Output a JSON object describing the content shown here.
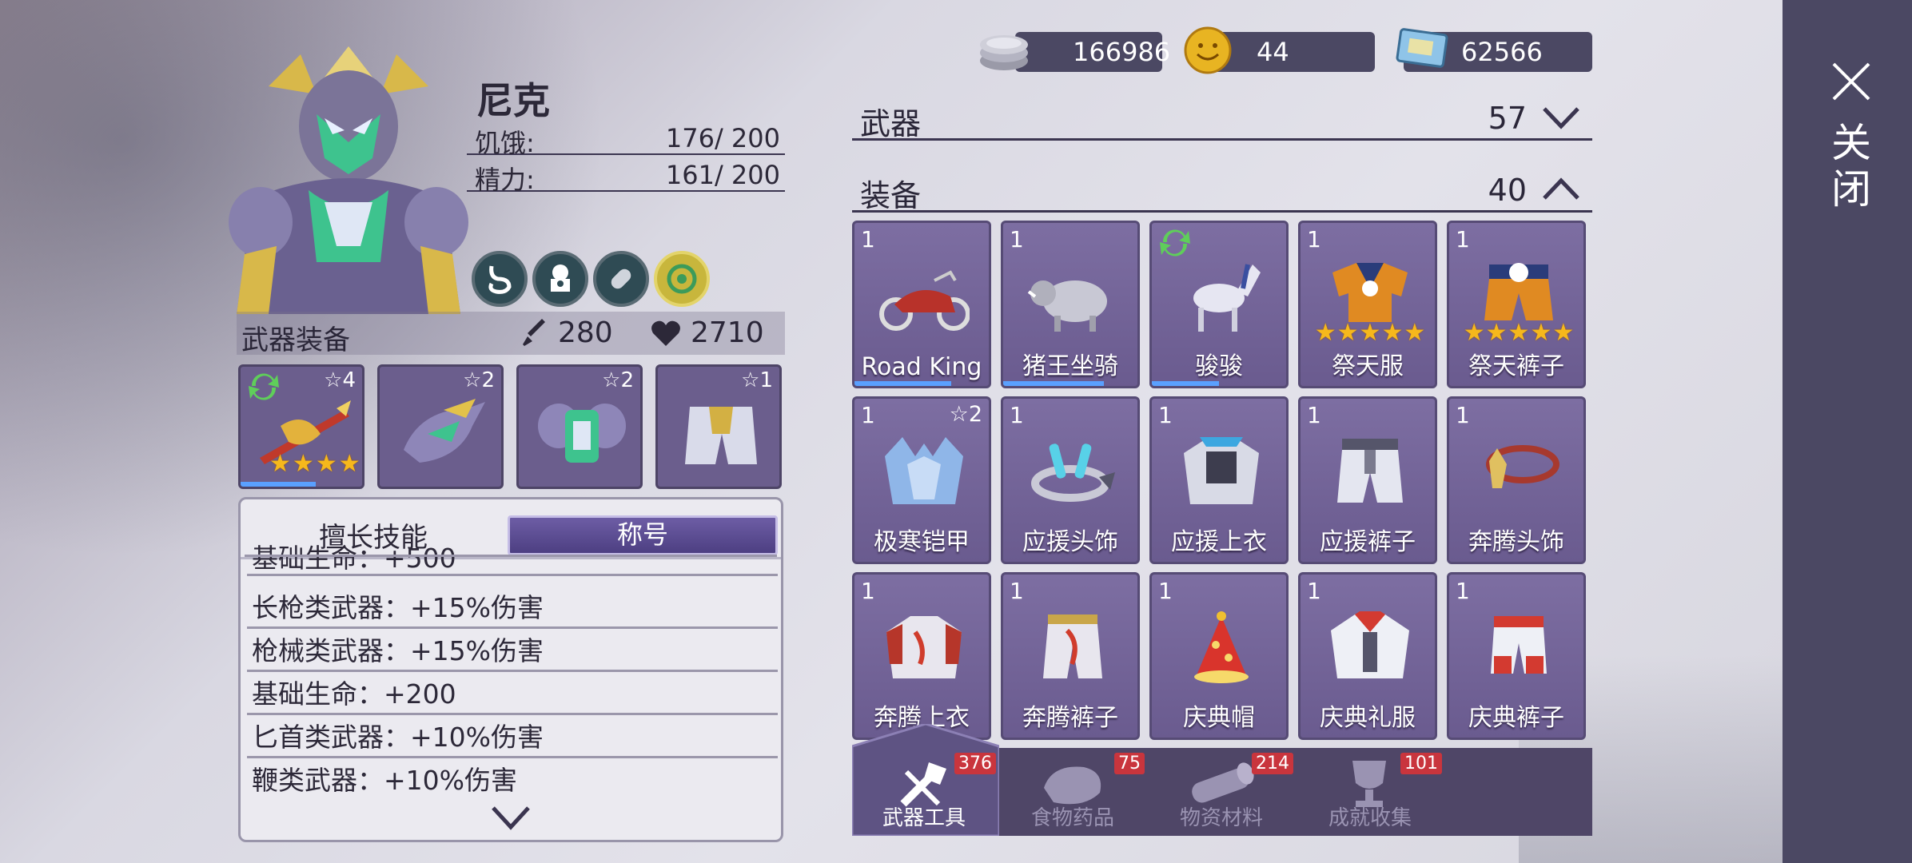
{
  "close": {
    "label": "关闭"
  },
  "currencies": [
    {
      "icon": "silver-coin-icon",
      "value": "166986"
    },
    {
      "icon": "gold-smiley-coin-icon",
      "value": "44"
    },
    {
      "icon": "ticket-icon",
      "value": "62566"
    }
  ],
  "character": {
    "name": "尼克",
    "stats": [
      {
        "label": "饥饿:",
        "value": "176/ 200"
      },
      {
        "label": "精力:",
        "value": "161/ 200"
      }
    ],
    "buffs": [
      "stomach-icon",
      "chef-icon",
      "bandage-icon",
      "shield-emblem-icon"
    ]
  },
  "weapon_equip": {
    "title": "武器装备",
    "attack": "280",
    "health": "2710",
    "slots": [
      {
        "name": "dragon-spear",
        "count": "☆4",
        "stars": 4,
        "refresh": true,
        "progress": 0.62
      },
      {
        "name": "dragon-helmet",
        "count": "☆2"
      },
      {
        "name": "armor",
        "count": "☆2"
      },
      {
        "name": "gold-pants",
        "count": "☆1"
      }
    ]
  },
  "skills": {
    "tab_skills": "擅长技能",
    "tab_title": "称号",
    "items": [
      "基础生命：+500",
      "长枪类武器：+15%伤害",
      "枪械类武器：+15%伤害",
      "基础生命：+200",
      "匕首类武器：+10%伤害",
      "鞭类武器：+10%伤害"
    ]
  },
  "inventory": {
    "weapons": {
      "label": "武器",
      "count": "57"
    },
    "equipment": {
      "label": "装备",
      "count": "40"
    },
    "items": [
      {
        "qty": "1",
        "name": "Road King",
        "icon": "motorcycle-icon",
        "progress": 0.72
      },
      {
        "qty": "1",
        "name": "猪王坐骑",
        "icon": "boar-mount-icon",
        "progress": 0.75
      },
      {
        "qty": "",
        "name": "骏骏",
        "icon": "horse-mount-icon",
        "progress": 0.5,
        "refresh": true
      },
      {
        "qty": "1",
        "name": "祭天服",
        "icon": "orange-gi-icon",
        "stars": 5
      },
      {
        "qty": "1",
        "name": "祭天裤子",
        "icon": "orange-pants-icon",
        "stars": 5
      },
      {
        "qty": "1",
        "name": "极寒铠甲",
        "icon": "ice-armor-icon",
        "smith": "☆2"
      },
      {
        "qty": "1",
        "name": "应援头饰",
        "icon": "headband-icon"
      },
      {
        "qty": "1",
        "name": "应援上衣",
        "icon": "cheer-jacket-icon"
      },
      {
        "qty": "1",
        "name": "应援裤子",
        "icon": "cheer-pants-icon"
      },
      {
        "qty": "1",
        "name": "奔腾头饰",
        "icon": "horse-headband-icon"
      },
      {
        "qty": "1",
        "name": "奔腾上衣",
        "icon": "dragon-jacket-icon"
      },
      {
        "qty": "1",
        "name": "奔腾裤子",
        "icon": "dragon-pants-icon"
      },
      {
        "qty": "1",
        "name": "庆典帽",
        "icon": "party-hat-icon"
      },
      {
        "qty": "1",
        "name": "庆典礼服",
        "icon": "celebration-suit-icon"
      },
      {
        "qty": "1",
        "name": "庆典裤子",
        "icon": "celebration-pants-icon"
      }
    ]
  },
  "bottom_tabs": [
    {
      "label": "武器工具",
      "badge": "376",
      "icon": "tools-icon",
      "active": true
    },
    {
      "label": "食物药品",
      "badge": "75",
      "icon": "meat-icon"
    },
    {
      "label": "物资材料",
      "badge": "214",
      "icon": "log-icon"
    },
    {
      "label": "成就收集",
      "badge": "101",
      "icon": "trophy-icon"
    }
  ]
}
